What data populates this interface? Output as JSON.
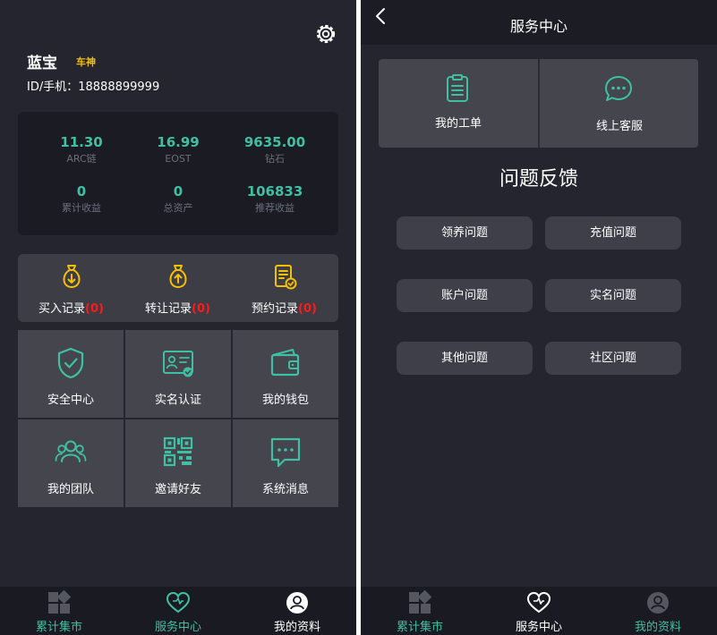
{
  "left": {
    "username": "蓝宝",
    "badge": "车神",
    "id_label": "ID/手机：",
    "id_value": "18888899999",
    "stats": [
      {
        "value": "11.30",
        "label": "ARC链"
      },
      {
        "value": "16.99",
        "label": "EOST"
      },
      {
        "value": "9635.00",
        "label": "钻石"
      },
      {
        "value": "0",
        "label": "累计收益"
      },
      {
        "value": "0",
        "label": "总资产"
      },
      {
        "value": "106833",
        "label": "推荐收益"
      }
    ],
    "records": [
      {
        "label": "买入记录",
        "count": "(0)",
        "icon": "money-bag-down-icon"
      },
      {
        "label": "转让记录",
        "count": "(0)",
        "icon": "money-bag-up-icon"
      },
      {
        "label": "预约记录",
        "count": "(0)",
        "icon": "document-check-icon"
      }
    ],
    "grid": [
      {
        "label": "安全中心",
        "icon": "shield-check-icon"
      },
      {
        "label": "实名认证",
        "icon": "id-card-icon"
      },
      {
        "label": "我的钱包",
        "icon": "wallet-icon"
      },
      {
        "label": "我的团队",
        "icon": "team-icon"
      },
      {
        "label": "邀请好友",
        "icon": "qr-code-icon"
      },
      {
        "label": "系统消息",
        "icon": "message-icon"
      }
    ]
  },
  "right": {
    "title": "服务中心",
    "services": [
      {
        "label": "我的工单",
        "icon": "clipboard-icon"
      },
      {
        "label": "线上客服",
        "icon": "chat-bubble-icon"
      }
    ],
    "feedback_title": "问题反馈",
    "feedback_buttons": [
      "领养问题",
      "充值问题",
      "账户问题",
      "实名问题",
      "其他问题",
      "社区问题"
    ]
  },
  "tabs": [
    "累计集市",
    "服务中心",
    "我的资料"
  ],
  "colors": {
    "background": "#24252f",
    "card": "#44454d",
    "accent": "#3fbfa3",
    "badge": "#f4c000",
    "count": "#ff1a1a",
    "tabbar": "#1a1b22"
  }
}
